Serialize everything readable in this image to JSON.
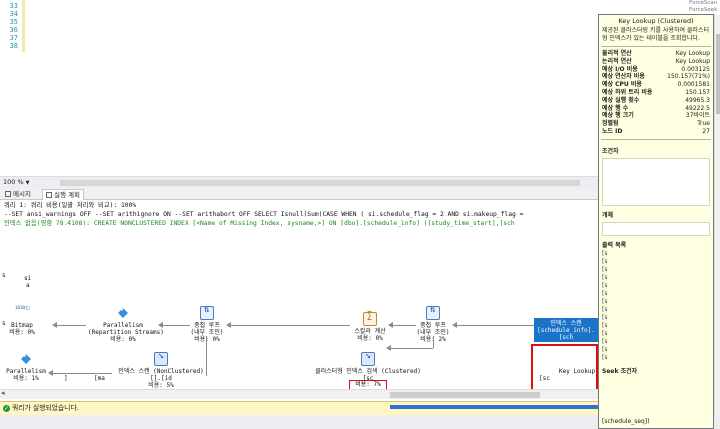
{
  "editor": {
    "line_numbers": [
      "33",
      "34",
      "35",
      "36",
      "37",
      "38"
    ],
    "zoom": "100 %"
  },
  "tabs": [
    {
      "label": "메시지"
    },
    {
      "label": "실행 계획"
    }
  ],
  "plan": {
    "query_line": "쿼리 1: 쿼리 비용(일괄 처리와 비교): 100%",
    "sql_line": "--SET ansi_warnings OFF --SET arithignore ON --SET arithabort OFF SELECT Isnull(Sum(CASE WHEN ( si.schedule_flag = 2 AND si.makeup_flag =",
    "missing_index": "인덱스 없음(영향 78.4108): CREATE NONCLUSTERED INDEX [<Name of Missing Index, sysname,>] ON [dbo].[schedule_info] ([study_time_start],[sch",
    "nodes": {
      "bitmap": {
        "title": "Bitmap",
        "cost": "비용: 0%"
      },
      "parallelism_top": {
        "title": "Parallelism",
        "sub": "(Repartition Streams)",
        "cost": "비용: 0%"
      },
      "nested_loops_1": {
        "title": "중첩 루프",
        "sub": "(내부 조인)",
        "cost": "비용: 0%"
      },
      "compute_scalar": {
        "title": "스칼라 계산",
        "cost": "비용: 0%"
      },
      "nested_loops_2": {
        "title": "중첩 루프",
        "sub": "(내부 조인)",
        "cost": "비용: 2%"
      },
      "parallelism_bottom": {
        "title": "Parallelism",
        "cost": "비용: 1%"
      },
      "index_seek_nc": {
        "title": "인덱스 스캔 (NonClustered)",
        "sub": "[].[id",
        "cost": "비용: 5%"
      },
      "clustered_seek": {
        "title": "클러스터형 인덱스 검색 (Clustered)",
        "sub": "[sc",
        "cost": "비용: 7%"
      },
      "key_lookup": {
        "title": "Key Lookup",
        "sub": "[sc"
      },
      "selected_node": {
        "line1": "인덱스 스캔",
        "line2": "[schedule_info].[sch"
      }
    },
    "small_labels": {
      "ma": "[ma",
      "sc_left": "[sc",
      "cb": "]",
      "si": "si",
      "a": "a",
      "s": "s",
      "f": "f"
    }
  },
  "status": {
    "message": "쿼리가 실행되었습니다."
  },
  "tooltip": {
    "title": "Key Lookup (Clustered)",
    "description": "제공된 클러스터링 키를 사용하여 클러스터형 인덱스가 있는 테이블을 조회합니다.",
    "props": [
      {
        "k": "물리적 연산",
        "v": "Key Lookup"
      },
      {
        "k": "논리적 연산",
        "v": "Key Lookup"
      },
      {
        "k": "예상 I/O 비용",
        "v": "0.003125"
      },
      {
        "k": "예상 연산자 비용",
        "v": "150.157(71%)"
      },
      {
        "k": "예상 CPU 비용",
        "v": "0.0001581"
      },
      {
        "k": "예상 하위 트리 비용",
        "v": "150.157"
      },
      {
        "k": "예상 실행 횟수",
        "v": "49965.3"
      },
      {
        "k": "예상 행 수",
        "v": "49222.5"
      },
      {
        "k": "예상 행 크기",
        "v": "37바이트"
      },
      {
        "k": "정렬됨",
        "v": "True"
      },
      {
        "k": "노드 ID",
        "v": "27"
      }
    ],
    "sec_predicate": "조건자",
    "sec_object": "개체",
    "sec_output": "출력 목록",
    "output_items": [
      "[s",
      "[s",
      "[s",
      "[s",
      "[s",
      "[s",
      "[s",
      "[s",
      "[s",
      "[s",
      "[s",
      "[s",
      "[s",
      "[s"
    ],
    "sec_seek": "Seek 조건자",
    "seek_value": "[schedule_seq])"
  },
  "topright": {
    "line1": "ForceScan",
    "line2": "ForceSeek"
  }
}
